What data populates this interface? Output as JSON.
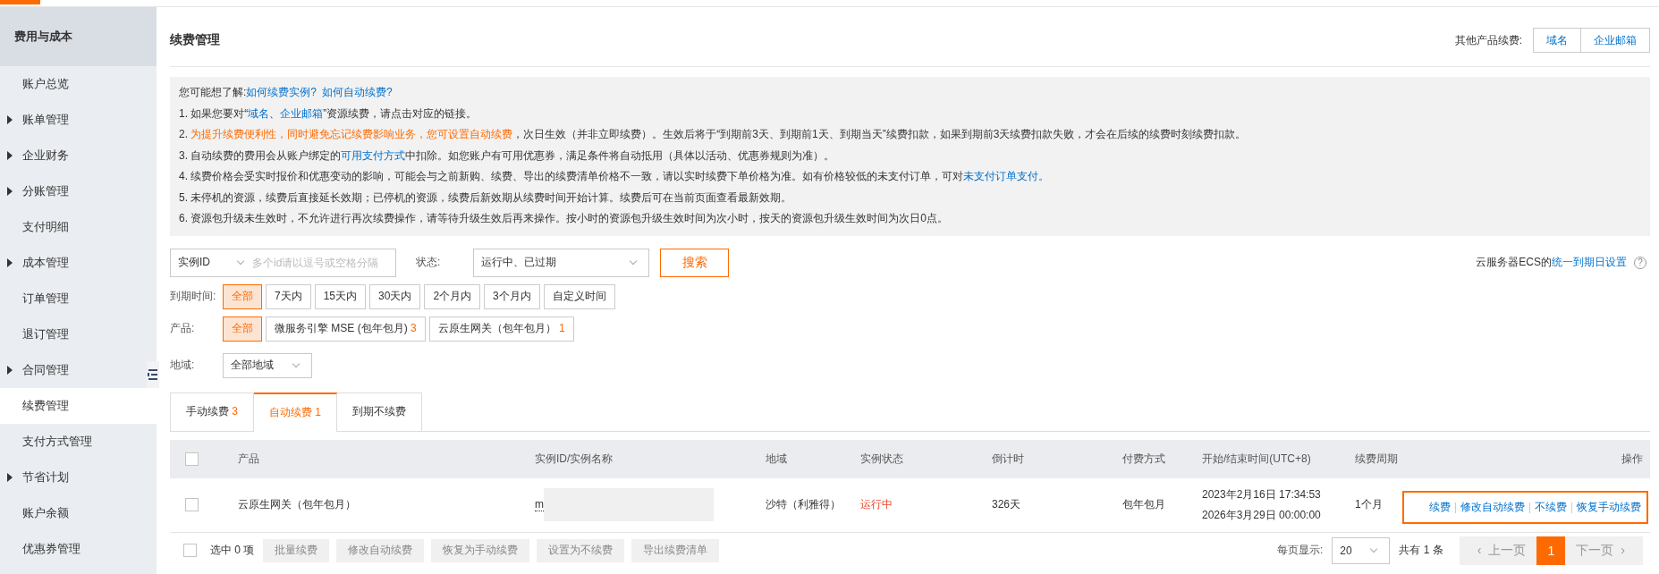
{
  "sidebar": {
    "title": "费用与成本",
    "items": [
      {
        "label": "账户总览",
        "has_children": false,
        "selected": false
      },
      {
        "label": "账单管理",
        "has_children": true,
        "selected": false
      },
      {
        "label": "企业财务",
        "has_children": true,
        "selected": false
      },
      {
        "label": "分账管理",
        "has_children": true,
        "selected": false
      },
      {
        "label": "支付明细",
        "has_children": false,
        "selected": false
      },
      {
        "label": "成本管理",
        "has_children": true,
        "selected": false
      },
      {
        "label": "订单管理",
        "has_children": false,
        "selected": false
      },
      {
        "label": "退订管理",
        "has_children": false,
        "selected": false
      },
      {
        "label": "合同管理",
        "has_children": true,
        "selected": false
      },
      {
        "label": "续费管理",
        "has_children": false,
        "selected": true
      },
      {
        "label": "支付方式管理",
        "has_children": false,
        "selected": false
      },
      {
        "label": "节省计划",
        "has_children": true,
        "selected": false
      },
      {
        "label": "账户余额",
        "has_children": false,
        "selected": false
      },
      {
        "label": "优惠券管理",
        "has_children": false,
        "selected": false
      }
    ]
  },
  "page_title": "续费管理",
  "other_products": {
    "label": "其他产品续费:",
    "buttons": [
      "域名",
      "企业邮箱"
    ]
  },
  "info": [
    [
      {
        "kind": "text",
        "text": "您可能想了解:"
      },
      {
        "kind": "link",
        "text": "如何续费实例?"
      },
      {
        "kind": "link",
        "text": "如何自动续费?"
      }
    ],
    [
      {
        "kind": "text",
        "text": "1. 如果您要对“"
      },
      {
        "kind": "link",
        "text": "域名"
      },
      {
        "kind": "text",
        "text": "、"
      },
      {
        "kind": "link",
        "text": "企业邮箱"
      },
      {
        "kind": "text",
        "text": "”资源续费，请点击对应的链接。"
      }
    ],
    [
      {
        "kind": "text",
        "text": "2. "
      },
      {
        "kind": "warn",
        "text": "为提升续费便利性，同时避免忘记续费影响业务，您可设置自动续费"
      },
      {
        "kind": "text",
        "text": "，次日生效（并非立即续费）。生效后将于“到期前3天、到期前1天、到期当天”续费扣款，如果到期前3天续费扣款失败，才会在后续的续费时刻续费扣款。"
      }
    ],
    [
      {
        "kind": "text",
        "text": "3. 自动续费的费用会从账户绑定的"
      },
      {
        "kind": "link",
        "text": "可用支付方式"
      },
      {
        "kind": "text",
        "text": "中扣除。如您账户有可用优惠券，满足条件将自动抵用（具体以活动、优惠券规则为准）。"
      }
    ],
    [
      {
        "kind": "text",
        "text": "4. 续费价格会受实时报价和优惠变动的影响，可能会与之前新购、续费、导出的续费清单价格不一致，请以实时续费下单价格为准。如有价格较低的未支付订单，可对"
      },
      {
        "kind": "link",
        "text": "未支付订单支付。"
      }
    ],
    [
      {
        "kind": "text",
        "text": "5. 未停机的资源，续费后直接延长效期；已停机的资源，续费后新效期从续费时间开始计算。续费后可在当前页面查看最新效期。"
      }
    ],
    [
      {
        "kind": "text",
        "text": "6. 资源包升级未生效时，不允许进行再次续费操作，请等待升级生效后再来操作。按小时的资源包升级生效时间为次小时，按天的资源包升级生效时间为次日0点。"
      }
    ]
  ],
  "search": {
    "field_type": "实例ID",
    "placeholder": "多个id请以逗号或空格分隔",
    "status_label": "状态:",
    "status_value": "运行中、已过期",
    "button": "搜索"
  },
  "ecs_setting": {
    "prefix": "云服务器ECS的",
    "link": "统一到期日设置",
    "help": "?"
  },
  "expiry_filter": {
    "label": "到期时间:",
    "options": [
      {
        "label": "全部",
        "selected": true
      },
      {
        "label": "7天内",
        "selected": false
      },
      {
        "label": "15天内",
        "selected": false
      },
      {
        "label": "30天内",
        "selected": false
      },
      {
        "label": "2个月内",
        "selected": false
      },
      {
        "label": "3个月内",
        "selected": false
      },
      {
        "label": "自定义时间",
        "selected": false
      }
    ]
  },
  "product_filter": {
    "label": "产品:",
    "options": [
      {
        "label": "全部",
        "selected": true
      },
      {
        "label": "微服务引擎 MSE (包年包月)",
        "count": "3",
        "selected": false
      },
      {
        "label": "云原生网关（包年包月）",
        "count": "1",
        "selected": false
      }
    ]
  },
  "region_filter": {
    "label": "地域:",
    "value": "全部地域"
  },
  "tabs": [
    {
      "label": "手动续费",
      "count": "3",
      "selected": false
    },
    {
      "label": "自动续费",
      "count": "1",
      "selected": true
    },
    {
      "label": "到期不续费",
      "selected": false
    }
  ],
  "table": {
    "all_checked": false,
    "columns": [
      "产品",
      "实例ID/实例名称",
      "地域",
      "实例状态",
      "倒计时",
      "付费方式",
      "开始/结束时间(UTC+8)",
      "续费周期",
      "操作"
    ],
    "rows": [
      {
        "checked": false,
        "product": "云原生网关（包年包月）",
        "instance_id": "m",
        "region": "沙特（利雅得）",
        "status": "运行中",
        "countdown": "326天",
        "billing": "包年包月",
        "start": "2023年2月16日 17:34:53",
        "end": "2026年3月29日 00:00:00",
        "period": "1个月",
        "actions": [
          "续费",
          "修改自动续费",
          "不续费",
          "恢复手动续费"
        ],
        "actions_highlighted": true
      }
    ]
  },
  "footer": {
    "checked": false,
    "selected_count": "选中 0 项",
    "buttons": [
      "批量续费",
      "修改自动续费",
      "恢复为手动续费",
      "设置为不续费",
      "导出续费清单"
    ]
  },
  "pagination": {
    "page_size_label": "每页显示:",
    "page_size": "20",
    "total": "共有 1 条",
    "prev_icon": "‹",
    "prev": "上一页",
    "next": "下一页",
    "next_icon": "›",
    "pages": [
      {
        "label": "1",
        "selected": true
      }
    ]
  }
}
